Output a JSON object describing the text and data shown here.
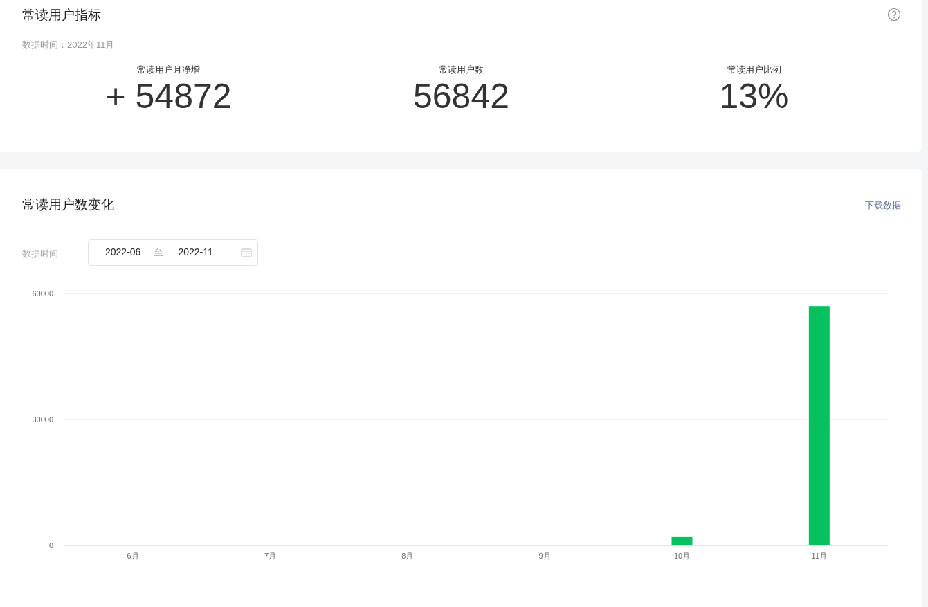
{
  "metrics_card": {
    "title": "常读用户指标",
    "data_time": "数据时间：2022年11月",
    "metrics": [
      {
        "label": "常读用户月净增",
        "value": "+ 54872"
      },
      {
        "label": "常读用户数",
        "value": "56842"
      },
      {
        "label": "常读用户比例",
        "value": "13%"
      }
    ]
  },
  "trend_card": {
    "title": "常读用户数变化",
    "download_link": "下载数据",
    "date_label": "数据时间",
    "date_start": "2022-06",
    "date_separator": "至",
    "date_end": "2022-11",
    "chart_data": {
      "type": "bar",
      "categories": [
        "6月",
        "7月",
        "8月",
        "9月",
        "10月",
        "11月"
      ],
      "series": [
        {
          "color": "#07c160",
          "values": [
            0,
            0,
            0,
            0,
            2000,
            57000
          ]
        }
      ],
      "ylim": [
        0,
        60000
      ],
      "yticks": [
        0,
        30000,
        60000
      ]
    }
  }
}
